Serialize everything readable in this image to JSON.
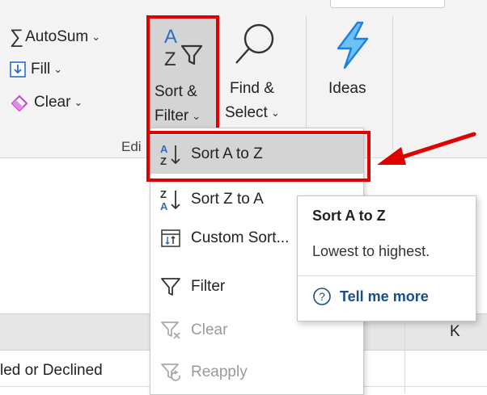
{
  "ribbon": {
    "autosum_label": "AutoSum",
    "fill_label": "Fill",
    "clear_label": "Clear",
    "sort_filter_line1": "Sort &",
    "sort_filter_line2": "Filter",
    "find_select_line1": "Find &",
    "find_select_line2": "Select",
    "ideas_label": "Ideas",
    "group_label_partial": "Edi"
  },
  "menu": {
    "items": [
      {
        "label": "Sort A to Z",
        "icon": "sort-a-to-z-icon",
        "enabled": true,
        "highlighted": true
      },
      {
        "label": "Sort Z to A",
        "icon": "sort-z-to-a-icon",
        "enabled": true
      },
      {
        "label": "Custom Sort...",
        "icon": "custom-sort-icon",
        "enabled": true
      },
      {
        "label": "Filter",
        "icon": "filter-icon",
        "enabled": true
      },
      {
        "label": "Clear",
        "icon": "clear-filter-icon",
        "enabled": false
      },
      {
        "label": "Reapply",
        "icon": "reapply-icon",
        "enabled": false
      }
    ]
  },
  "tooltip": {
    "title": "Sort A to Z",
    "description": "Lowest to highest.",
    "help_link": "Tell me more"
  },
  "sheet": {
    "column_header": "K",
    "cell_text": "led or Declined"
  },
  "colors": {
    "annotation_red": "#e00000",
    "ideas_blue": "#1e7fe0",
    "highlight_gray": "#d4d4d4",
    "link_blue": "#1a4e8a"
  }
}
